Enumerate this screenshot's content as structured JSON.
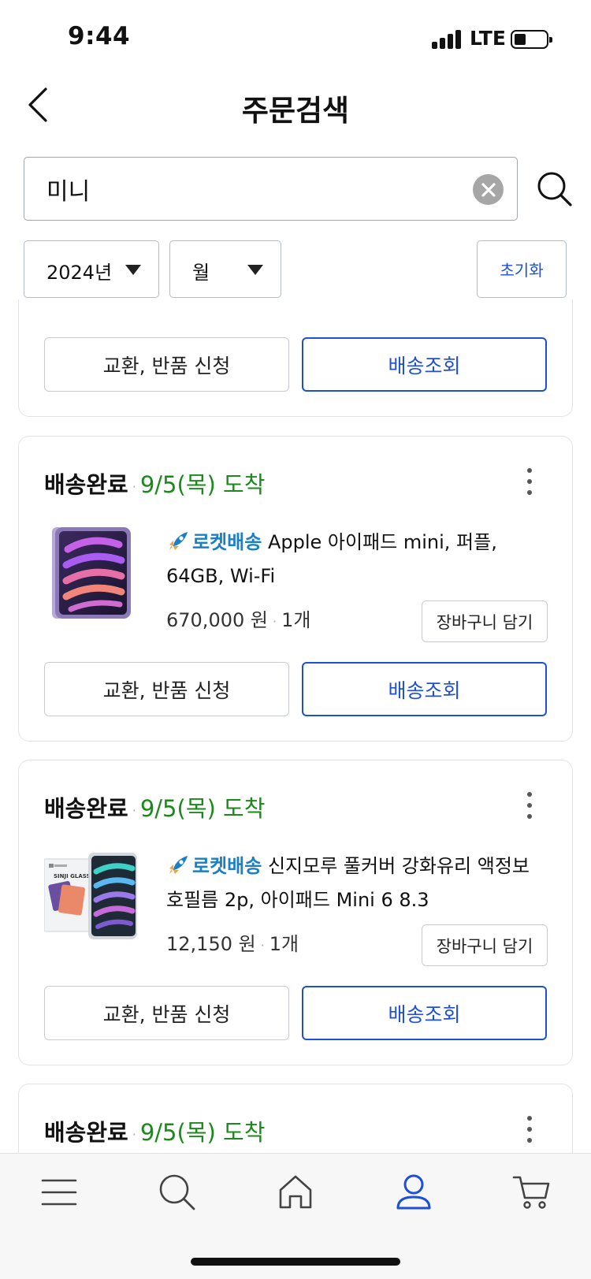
{
  "status_bar": {
    "time": "9:44",
    "network": "LTE"
  },
  "header": {
    "title": "주문검색",
    "back_icon": "chevron-left-icon"
  },
  "search": {
    "value": "미니",
    "clear_icon": "close-circle-icon",
    "search_icon": "search-icon"
  },
  "filters": {
    "year": "2024년",
    "month": "월",
    "reset_label": "초기화"
  },
  "colors": {
    "accent_blue": "#1e4fd8",
    "arrival_green": "#1a8a1a",
    "rocket_blue": "#1a7fc4",
    "border_gray": "#c7cbd1"
  },
  "partial_card": {
    "exchange_label": "교환, 반품 신청",
    "tracking_label": "배송조회"
  },
  "orders": [
    {
      "status": "배송완료",
      "arrival": "9/5(목) 도착",
      "badge": "로켓배송",
      "title": "Apple 아이패드 mini, 퍼플, 64GB, Wi-Fi",
      "price": "670,000 원",
      "qty": "1개",
      "cart_label": "장바구니 담기",
      "exchange_label": "교환, 반품 신청",
      "tracking_label": "배송조회"
    },
    {
      "status": "배송완료",
      "arrival": "9/5(목) 도착",
      "badge": "로켓배송",
      "title": "신지모루 풀커버 강화유리 액정보호필름 2p, 아이패드 Mini 6 8.3",
      "price": "12,150 원",
      "qty": "1개",
      "cart_label": "장바구니 담기",
      "exchange_label": "교환, 반품 신청",
      "tracking_label": "배송조회",
      "package_text": "SINJI GLASS"
    },
    {
      "status": "배송완료",
      "arrival": "9/5(목) 도착"
    }
  ],
  "tabbar": {
    "items": [
      "menu-icon",
      "search-icon",
      "home-icon",
      "profile-icon",
      "cart-icon"
    ],
    "active": "profile-icon"
  }
}
